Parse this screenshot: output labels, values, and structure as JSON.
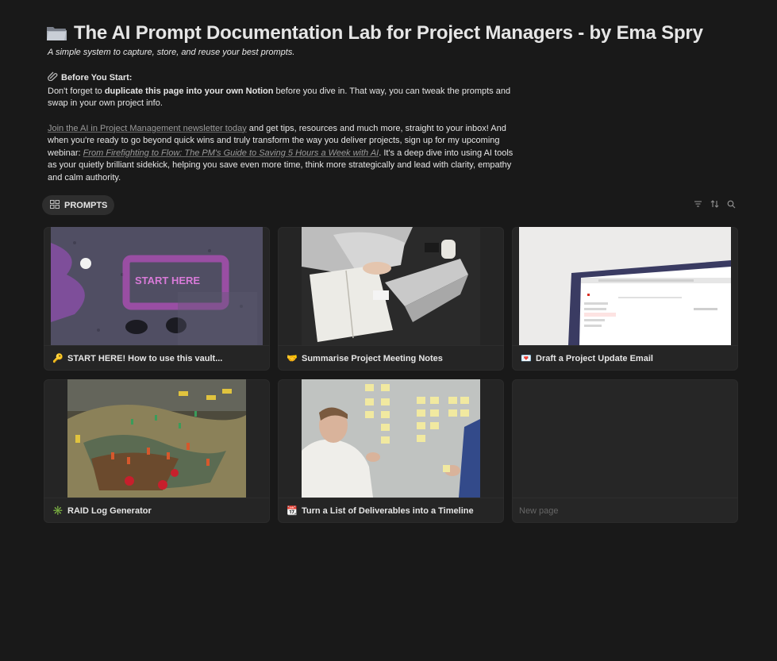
{
  "page": {
    "icon": "folder-icon",
    "title": "The AI Prompt Documentation Lab for Project Managers - by Ema Spry",
    "subtitle": "A simple system to capture, store, and reuse your best prompts."
  },
  "before": {
    "icon": "paperclip-icon",
    "heading": "Before You Start:",
    "line_pre": "Don't forget to ",
    "line_bold": "duplicate this page into your own Notion",
    "line_post": " before you dive in. That way, you can tweak the prompts and swap in your own project info."
  },
  "promo": {
    "newsletter_link": "Join the AI in Project Management newsletter today",
    "text1": " and get tips, resources and much more, straight to your inbox! And when you're ready to go beyond quick wins and truly transform the way you deliver projects, sign up for my upcoming webinar: ",
    "webinar_link": "From Firefighting to Flow: The PM's Guide to Saving 5 Hours a Week with AI",
    "text2": ". It's a deep dive into using AI tools as your quietly brilliant sidekick, helping you save even more time, think more strategically and lead with clarity, empathy and calm authority."
  },
  "database": {
    "view_icon": "gallery-icon",
    "view_label": "PROMPTS",
    "toolbar": [
      "filter-icon",
      "sort-icon",
      "search-icon"
    ]
  },
  "cards": [
    {
      "emoji": "🔑",
      "icon": "key-icon",
      "title": "START HERE! How to use this vault..."
    },
    {
      "emoji": "🤝",
      "icon": "handshake-icon",
      "title": "Summarise Project Meeting Notes"
    },
    {
      "emoji": "💌",
      "icon": "love-letter-icon",
      "title": "Draft a Project Update Email"
    },
    {
      "emoji": "✳️",
      "icon": "asterisk-icon",
      "title": "RAID Log Generator"
    },
    {
      "emoji": "📆",
      "icon": "calendar-icon",
      "title": "Turn a List of Deliverables into a Timeline"
    }
  ],
  "new_page": {
    "label": "New page"
  },
  "image_text": {
    "start_here": "START HERE"
  }
}
